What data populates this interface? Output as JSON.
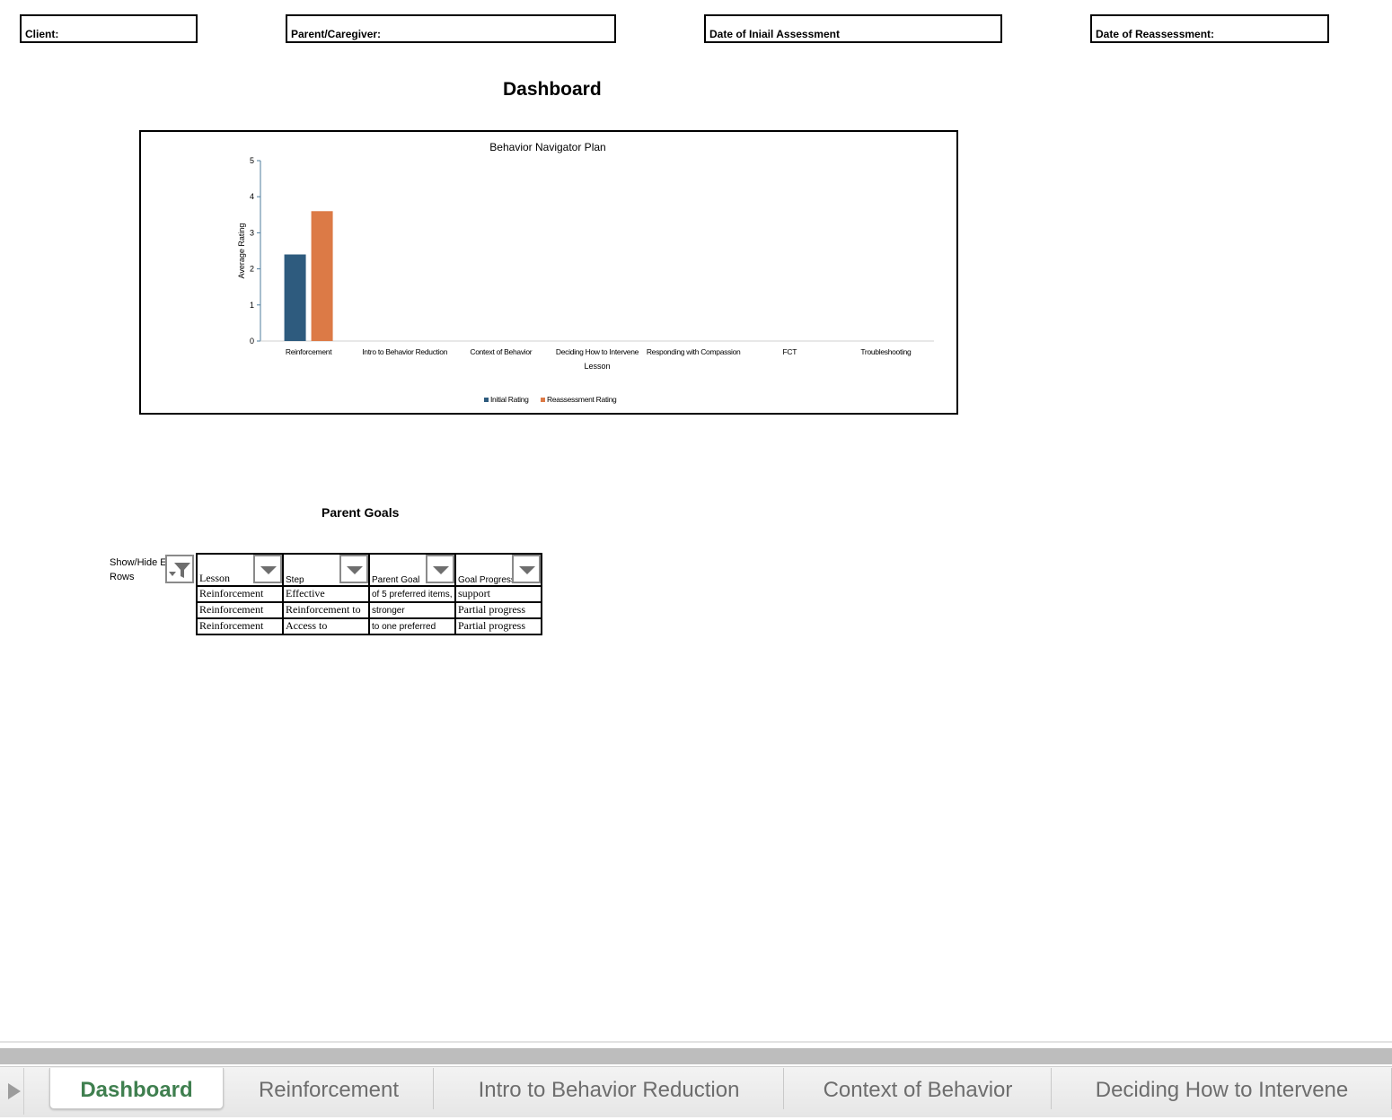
{
  "fields": {
    "client": "Client:",
    "parent": "Parent/Caregiver:",
    "initial_date": "Date of Iniail Assessment",
    "reassess_date": "Date of Reassessment:"
  },
  "dashboard_title": "Dashboard",
  "chart_data": {
    "type": "bar",
    "title": "Behavior Navigator Plan",
    "xlabel": "Lesson",
    "ylabel": "Average Rating",
    "ylim": [
      0,
      5
    ],
    "yticks": [
      0,
      1,
      2,
      3,
      4,
      5
    ],
    "categories": [
      "Reinforcement",
      "Intro to Behavior Reduction",
      "Context of Behavior",
      "Deciding How to Intervene",
      "Responding with Compassion",
      "FCT",
      "Troubleshooting"
    ],
    "series": [
      {
        "name": "Initial Rating",
        "color": "#2e5b7e",
        "values": [
          2.4,
          null,
          null,
          null,
          null,
          null,
          null
        ]
      },
      {
        "name": "Reassessment Rating",
        "color": "#dc7a46",
        "values": [
          3.6,
          null,
          null,
          null,
          null,
          null,
          null
        ]
      }
    ],
    "legend_position": "bottom",
    "grid": false
  },
  "goals": {
    "title": "Parent Goals",
    "filter_label": "Show/Hide Empty Rows",
    "headers": [
      "Lesson",
      "Step",
      "Parent Goal",
      "Goal Progress"
    ],
    "rows": [
      [
        "Reinforcement",
        "Effective",
        "of 5 preferred items,",
        "support"
      ],
      [
        "Reinforcement",
        "Reinforcement to",
        "stronger",
        "Partial progress"
      ],
      [
        "Reinforcement",
        "Access to",
        "to one preferred",
        "Partial progress"
      ]
    ]
  },
  "tabs": [
    "Dashboard",
    "Reinforcement",
    "Intro to Behavior Reduction",
    "Context of Behavior",
    "Deciding How to Intervene"
  ],
  "active_tab": "Dashboard"
}
